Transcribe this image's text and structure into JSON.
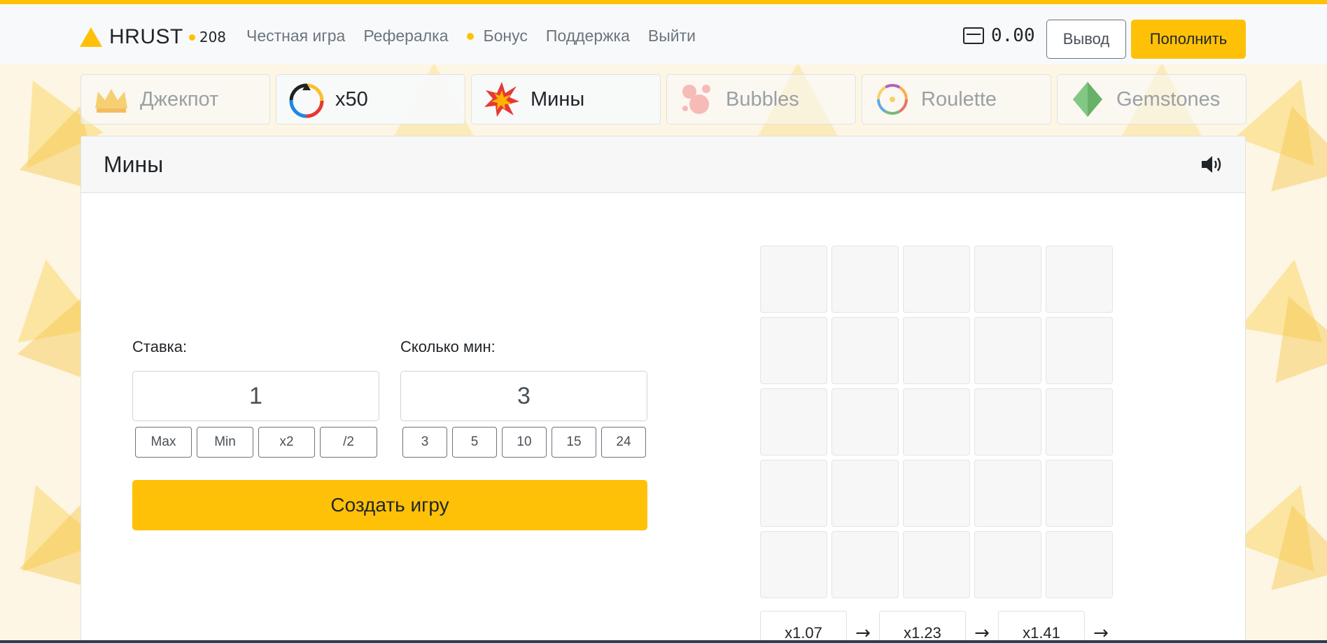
{
  "header": {
    "brand": "HRUST",
    "online_count": "208",
    "nav": [
      {
        "label": "Честная игра",
        "dot": false
      },
      {
        "label": "Рефералка",
        "dot": false
      },
      {
        "label": "Бонус",
        "dot": true
      },
      {
        "label": "Поддержка",
        "dot": false
      },
      {
        "label": "Выйти",
        "dot": false
      }
    ],
    "balance": "0.00",
    "withdraw_label": "Вывод",
    "deposit_label": "Пополнить"
  },
  "tabs": [
    {
      "label": "Джекпот",
      "icon": "crown-icon"
    },
    {
      "label": "x50",
      "icon": "wheel-icon"
    },
    {
      "label": "Мины",
      "icon": "explosion-icon"
    },
    {
      "label": "Bubbles",
      "icon": "bubbles-icon"
    },
    {
      "label": "Roulette",
      "icon": "roulette-icon"
    },
    {
      "label": "Gemstones",
      "icon": "gem-icon"
    }
  ],
  "game": {
    "title": "Мины",
    "bet_label": "Ставка:",
    "bet_value": "1",
    "bet_buttons": [
      "Max",
      "Min",
      "x2",
      "/2"
    ],
    "mines_label": "Сколько мин:",
    "mines_value": "3",
    "mines_buttons": [
      "3",
      "5",
      "10",
      "15",
      "24"
    ],
    "create_label": "Создать игру",
    "coefficients": [
      "x1.07",
      "x1.23",
      "x1.41"
    ],
    "arrow": "→"
  },
  "colors": {
    "accent": "#ffc107",
    "background": "#fdf6e4"
  }
}
